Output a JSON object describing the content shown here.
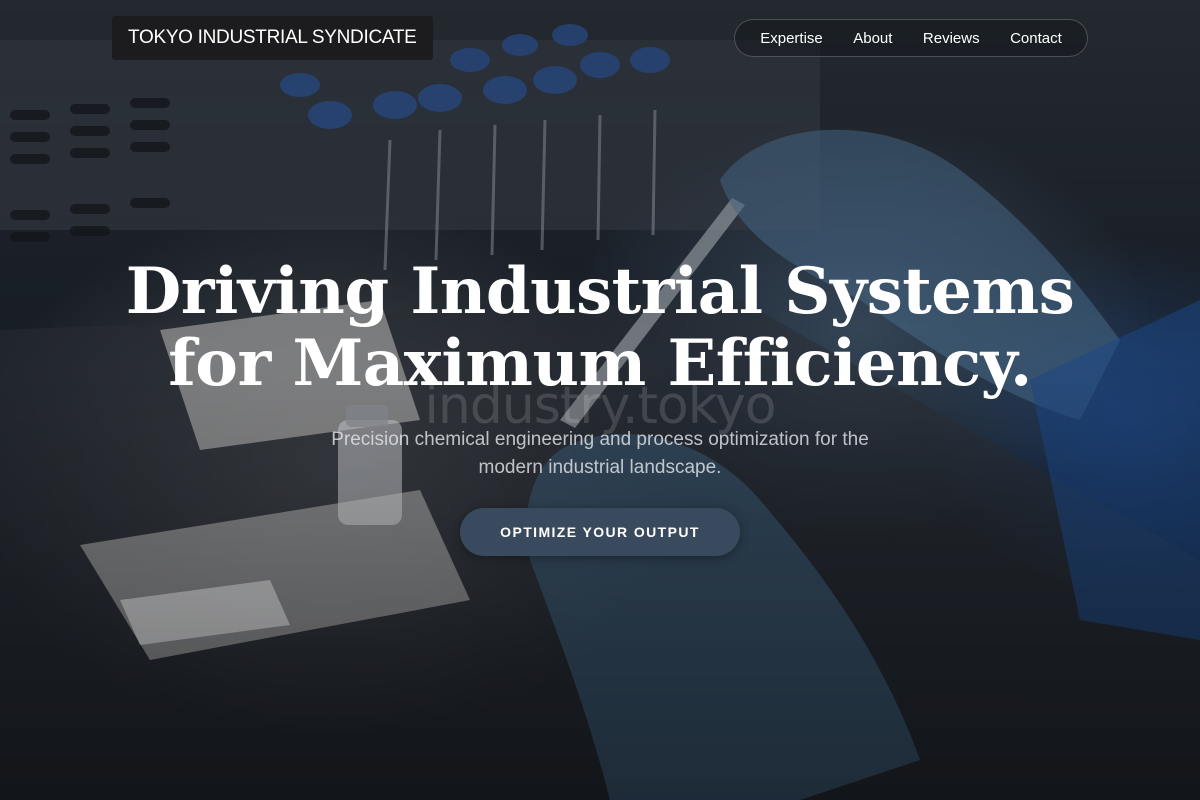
{
  "brand": {
    "name": "TOKYO INDUSTRIAL SYNDICATE"
  },
  "nav": {
    "items": [
      {
        "label": "Expertise"
      },
      {
        "label": "About"
      },
      {
        "label": "Reviews"
      },
      {
        "label": "Contact"
      }
    ]
  },
  "hero": {
    "headline_line1": "Driving Industrial Systems",
    "headline_line2": "for Maximum Efficiency.",
    "watermark": "industry.tokyo",
    "subtitle_line1": "Precision chemical engineering and process optimization for the",
    "subtitle_line2": "modern industrial landscape.",
    "cta_label": "OPTIMIZE YOUR OUTPUT"
  },
  "colors": {
    "cta_background": "#3a4a5e",
    "logo_background": "#1c1c1e",
    "glove_blue": "#4a6f8f",
    "vial_cap_blue": "#2c4f8a"
  }
}
